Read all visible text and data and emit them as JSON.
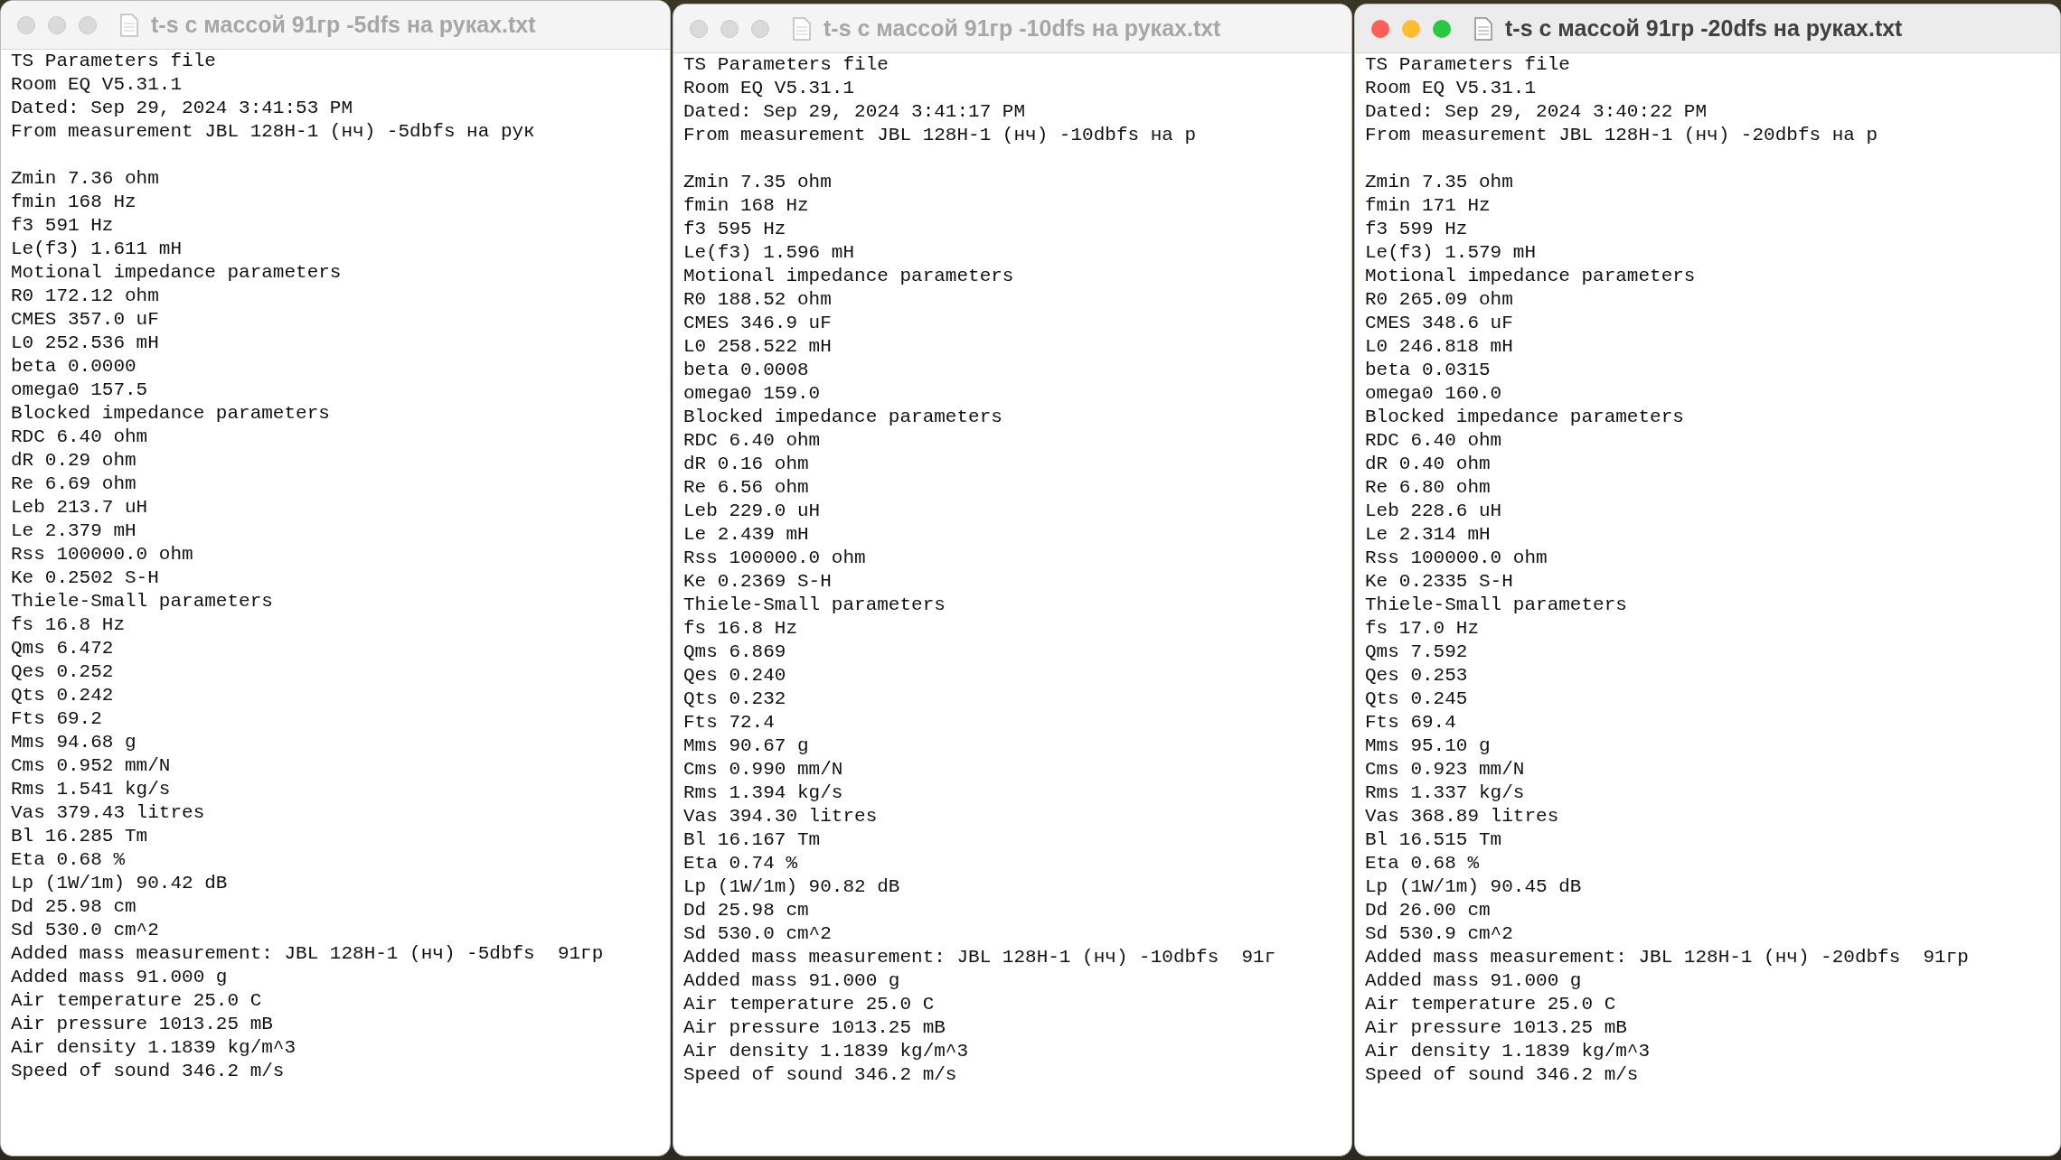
{
  "windows": [
    {
      "title": "t-s с массой 91гр -5dfs на руках.txt",
      "active": false,
      "blocks": [
        [
          "TS Parameters file",
          "Room EQ V5.31.1",
          "Dated: Sep 29, 2024 3:41:53 PM",
          "From measurement JBL 128H-1 (нч) -5dbfs на рук"
        ],
        [
          "Zmin 7.36 ohm",
          "fmin 168 Hz",
          "f3 591 Hz",
          "Le(f3) 1.611 mH",
          "Motional impedance parameters",
          "R0 172.12 ohm",
          "CMES 357.0 uF",
          "L0 252.536 mH",
          "beta 0.0000",
          "omega0 157.5",
          "Blocked impedance parameters",
          "RDC 6.40 ohm",
          "dR 0.29 ohm",
          "Re 6.69 ohm",
          "Leb 213.7 uH",
          "Le 2.379 mH",
          "Rss 100000.0 ohm",
          "Ke 0.2502 S-H",
          "Thiele-Small parameters",
          "fs 16.8 Hz",
          "Qms 6.472",
          "Qes 0.252",
          "Qts 0.242",
          "Fts 69.2",
          "Mms 94.68 g",
          "Cms 0.952 mm/N",
          "Rms 1.541 kg/s",
          "Vas 379.43 litres",
          "Bl 16.285 Tm",
          "Eta 0.68 %",
          "Lp (1W/1m) 90.42 dB",
          "Dd 25.98 cm",
          "Sd 530.0 cm^2",
          "Added mass measurement: JBL 128H-1 (нч) -5dbfs  91гр",
          "Added mass 91.000 g",
          "Air temperature 25.0 C",
          "Air pressure 1013.25 mB",
          "Air density 1.1839 kg/m^3",
          "Speed of sound 346.2 m/s"
        ]
      ]
    },
    {
      "title": "t-s с массой 91гр -10dfs на руках.txt",
      "active": false,
      "blocks": [
        [
          "TS Parameters file",
          "Room EQ V5.31.1",
          "Dated: Sep 29, 2024 3:41:17 PM",
          "From measurement JBL 128H-1 (нч) -10dbfs на р"
        ],
        [
          "Zmin 7.35 ohm",
          "fmin 168 Hz",
          "f3 595 Hz",
          "Le(f3) 1.596 mH",
          "Motional impedance parameters",
          "R0 188.52 ohm",
          "CMES 346.9 uF",
          "L0 258.522 mH",
          "beta 0.0008",
          "omega0 159.0",
          "Blocked impedance parameters",
          "RDC 6.40 ohm",
          "dR 0.16 ohm",
          "Re 6.56 ohm",
          "Leb 229.0 uH",
          "Le 2.439 mH",
          "Rss 100000.0 ohm",
          "Ke 0.2369 S-H",
          "Thiele-Small parameters",
          "fs 16.8 Hz",
          "Qms 6.869",
          "Qes 0.240",
          "Qts 0.232",
          "Fts 72.4",
          "Mms 90.67 g",
          "Cms 0.990 mm/N",
          "Rms 1.394 kg/s",
          "Vas 394.30 litres",
          "Bl 16.167 Tm",
          "Eta 0.74 %",
          "Lp (1W/1m) 90.82 dB",
          "Dd 25.98 cm",
          "Sd 530.0 cm^2",
          "Added mass measurement: JBL 128H-1 (нч) -10dbfs  91г",
          "Added mass 91.000 g",
          "Air temperature 25.0 C",
          "Air pressure 1013.25 mB",
          "Air density 1.1839 kg/m^3",
          "Speed of sound 346.2 m/s"
        ]
      ]
    },
    {
      "title": "t-s с массой 91гр -20dfs на руках.txt",
      "active": true,
      "blocks": [
        [
          "TS Parameters file",
          "Room EQ V5.31.1",
          "Dated: Sep 29, 2024 3:40:22 PM",
          "From measurement JBL 128H-1 (нч) -20dbfs на р"
        ],
        [
          "Zmin 7.35 ohm",
          "fmin 171 Hz",
          "f3 599 Hz",
          "Le(f3) 1.579 mH",
          "Motional impedance parameters",
          "R0 265.09 ohm",
          "CMES 348.6 uF",
          "L0 246.818 mH",
          "beta 0.0315",
          "omega0 160.0",
          "Blocked impedance parameters",
          "RDC 6.40 ohm",
          "dR 0.40 ohm",
          "Re 6.80 ohm",
          "Leb 228.6 uH",
          "Le 2.314 mH",
          "Rss 100000.0 ohm",
          "Ke 0.2335 S-H",
          "Thiele-Small parameters",
          "fs 17.0 Hz",
          "Qms 7.592",
          "Qes 0.253",
          "Qts 0.245",
          "Fts 69.4",
          "Mms 95.10 g",
          "Cms 0.923 mm/N",
          "Rms 1.337 kg/s",
          "Vas 368.89 litres",
          "Bl 16.515 Tm",
          "Eta 0.68 %",
          "Lp (1W/1m) 90.45 dB",
          "Dd 26.00 cm",
          "Sd 530.9 cm^2",
          "Added mass measurement: JBL 128H-1 (нч) -20dbfs  91гр",
          "Added mass 91.000 g",
          "Air temperature 25.0 C",
          "Air pressure 1013.25 mB",
          "Air density 1.1839 kg/m^3",
          "Speed of sound 346.2 m/s"
        ]
      ]
    }
  ]
}
